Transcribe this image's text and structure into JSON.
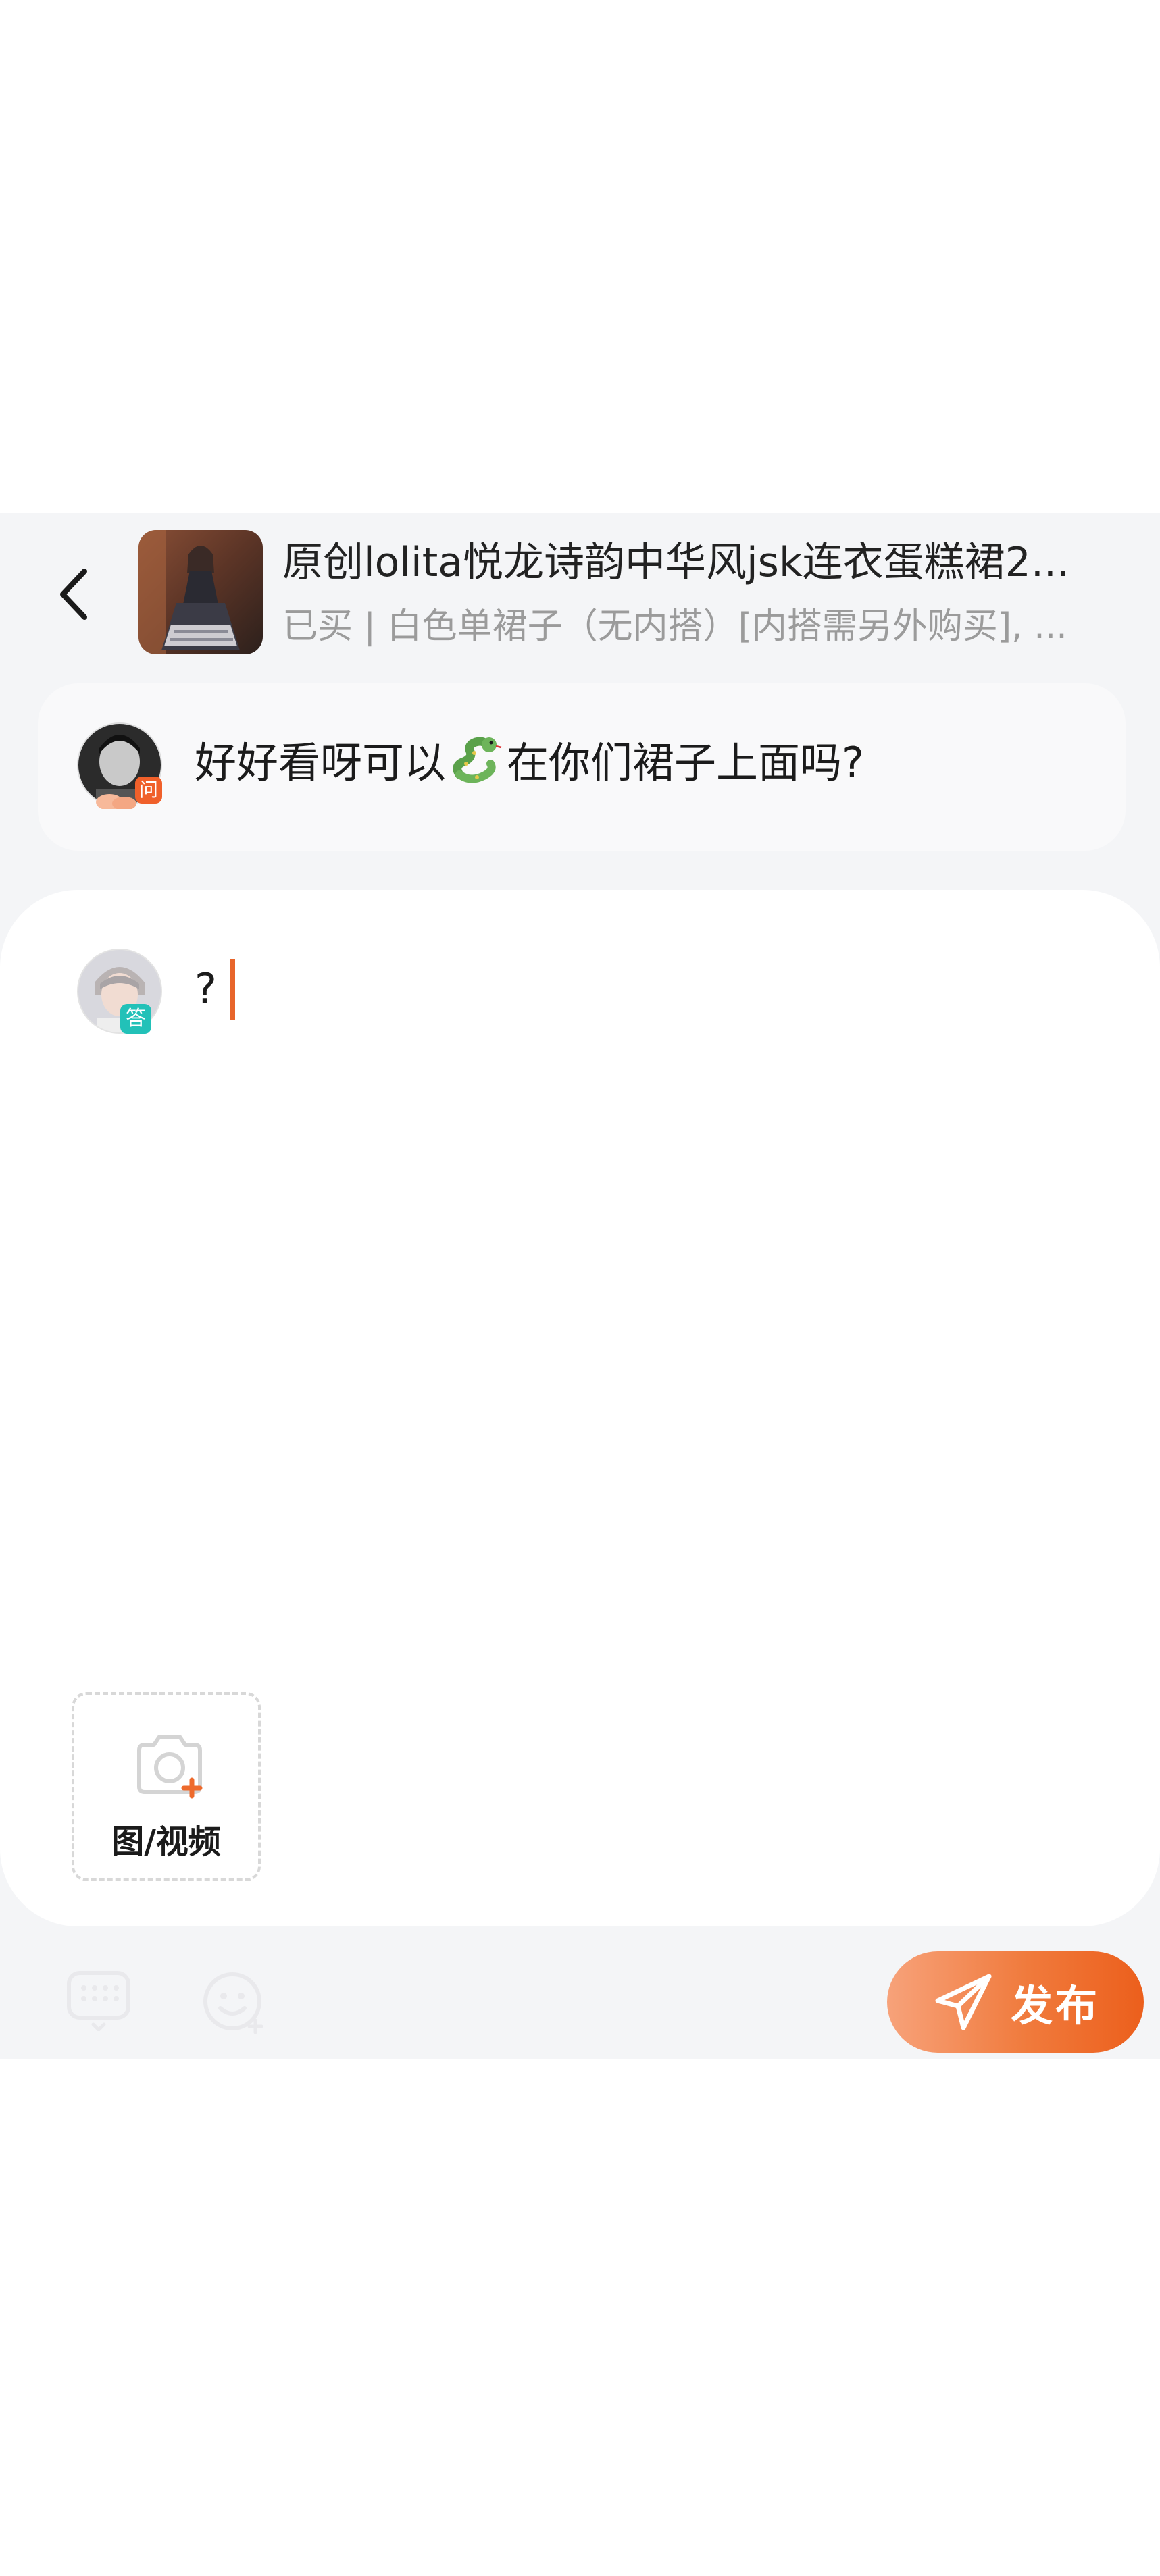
{
  "product": {
    "thumbnail_icon": "dress-photo-thumbnail",
    "title": "原创lolita悦龙诗韵中华风jsk连衣蛋糕裙2...",
    "spec": "已买 | 白色单裙子（无内搭）[内搭需另外购买], ..."
  },
  "question": {
    "avatar_icon": "user-avatar",
    "badge": "问",
    "text_before": "好好看呀可以",
    "emoji_icon": "snake-emoji-icon",
    "text_after": "在你们裙子上面吗?"
  },
  "answer": {
    "avatar_icon": "user-avatar",
    "badge": "答",
    "value": "?"
  },
  "upload": {
    "label": "图/视频",
    "icon": "camera-plus-icon"
  },
  "toolbar": {
    "keyboard_icon": "keyboard-icon",
    "emoji_icon": "emoji-face-icon"
  },
  "publish": {
    "label": "发布",
    "icon": "send-plane-icon"
  },
  "colors": {
    "accent": "#ee6a2c",
    "panel_bg": "#f4f5f7",
    "answer_badge": "#22c1b8",
    "question_badge": "#f0602a"
  }
}
